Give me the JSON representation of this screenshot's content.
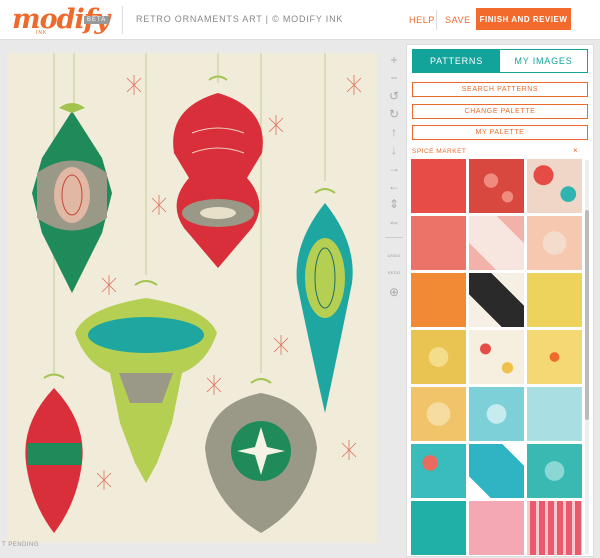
{
  "header": {
    "logo": "modify",
    "logo_sub": "INK",
    "beta": "BETA",
    "title": "RETRO ORNAMENTS ART | © MODIFY INK",
    "help": "HELP",
    "save": "SAVE",
    "finish": "FINISH AND REVIEW"
  },
  "canvas": {
    "status": "T PENDING"
  },
  "toolbar": {
    "undo": "UNDO",
    "redo": "REDO",
    "tools": [
      "zoom-in-icon",
      "zoom-out-icon",
      "rotate-left-icon",
      "rotate-right-icon",
      "move-up-icon",
      "move-down-icon",
      "move-right-icon",
      "move-left-icon",
      "flip-vertical-icon",
      "flip-horizontal-icon",
      "add-icon"
    ]
  },
  "panel": {
    "tabs": [
      {
        "label": "PATTERNS",
        "active": true
      },
      {
        "label": "MY IMAGES",
        "active": false
      }
    ],
    "buttons": {
      "search": "SEARCH PATTERNS",
      "change": "CHANGE PALETTE",
      "my_palette": "MY PALETTE"
    },
    "palette_name": "SPICE MARKET",
    "close": "×"
  },
  "colors": {
    "accent": "#ee6a2c",
    "teal": "#12a39b",
    "canvas_bg": "#f1ebda"
  }
}
